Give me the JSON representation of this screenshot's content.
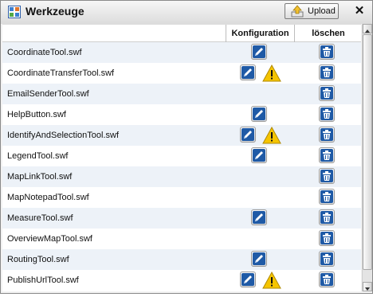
{
  "window": {
    "title": "Werkzeuge",
    "upload_label": "Upload",
    "close_label": "✕"
  },
  "table": {
    "headers": [
      "",
      "Konfiguration",
      "löschen"
    ],
    "rows": [
      {
        "name": "CoordinateTool.swf",
        "edit": true,
        "warning": false,
        "delete": true
      },
      {
        "name": "CoordinateTransferTool.swf",
        "edit": true,
        "warning": true,
        "delete": true
      },
      {
        "name": "EmailSenderTool.swf",
        "edit": false,
        "warning": false,
        "delete": true
      },
      {
        "name": "HelpButton.swf",
        "edit": true,
        "warning": false,
        "delete": true
      },
      {
        "name": "IdentifyAndSelectionTool.swf",
        "edit": true,
        "warning": true,
        "delete": true
      },
      {
        "name": "LegendTool.swf",
        "edit": true,
        "warning": false,
        "delete": true
      },
      {
        "name": "MapLinkTool.swf",
        "edit": false,
        "warning": false,
        "delete": true
      },
      {
        "name": "MapNotepadTool.swf",
        "edit": false,
        "warning": false,
        "delete": true
      },
      {
        "name": "MeasureTool.swf",
        "edit": true,
        "warning": false,
        "delete": true
      },
      {
        "name": "OverviewMapTool.swf",
        "edit": false,
        "warning": false,
        "delete": true
      },
      {
        "name": "RoutingTool.swf",
        "edit": true,
        "warning": false,
        "delete": true
      },
      {
        "name": "PublishUrlTool.swf",
        "edit": true,
        "warning": true,
        "delete": true
      }
    ]
  },
  "icons": {
    "title": "window-grid-icon",
    "upload": "upload-icon",
    "edit": "pencil-icon",
    "warning": "warning-icon",
    "delete": "trash-icon"
  },
  "colors": {
    "accent_blue": "#1f5aa6",
    "row_alt": "#edf2f8",
    "warning": "#f5c400"
  }
}
